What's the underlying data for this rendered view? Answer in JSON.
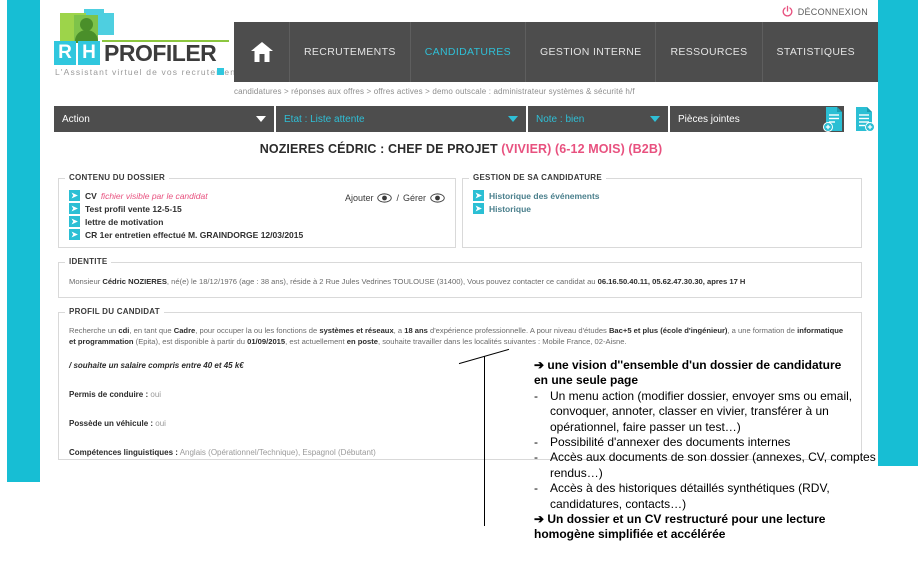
{
  "brand": {
    "letters": [
      "R",
      "H"
    ],
    "word": "PROFILER",
    "tagline": "L'Assistant  virtuel  de  vos  recrutements",
    "accent": "#30c7de",
    "green": "#8cc63f"
  },
  "topbar": {
    "logout_label": "DÉCONNEXION",
    "logout_icon": "power-icon"
  },
  "nav": {
    "home_icon": "house-icon",
    "items": [
      {
        "label": "RECRUTEMENTS",
        "active": false
      },
      {
        "label": "CANDIDATURES",
        "active": true
      },
      {
        "label": "GESTION INTERNE",
        "active": false
      },
      {
        "label": "RESSOURCES",
        "active": false
      },
      {
        "label": "STATISTIQUES",
        "active": false
      }
    ],
    "active_color": "#2fbfd6",
    "bar_color": "#4d4d4d"
  },
  "breadcrumb": {
    "text": "candidatures > réponses aux offres > offres actives > demo outscale : administrateur systèmes & sécurité h/f"
  },
  "toolbar": {
    "action_label": "Action",
    "etat_label": "Etat : Liste attente",
    "note_label": "Note : bien",
    "pieces_jointes_label": "Pièces jointes",
    "icons": [
      "document-add-icon",
      "document-list-add-icon"
    ]
  },
  "candidate": {
    "title_main": "NOZIERES CÉDRIC : CHEF DE PROJET",
    "title_tags": "(VIVIER) (6-12 MOIS) (B2B)",
    "tag_color": "#e8517f"
  },
  "contenu_dossier": {
    "legend": "CONTENU DU DOSSIER",
    "items": [
      {
        "label": "CV",
        "note": "fichier visible par le candidat"
      },
      {
        "label": "Test profil vente 12-5-15",
        "note": ""
      },
      {
        "label": "lettre de motivation",
        "note": ""
      },
      {
        "label": "CR 1er entretien effectué M. GRAINDORGE 12/03/2015",
        "note": ""
      }
    ],
    "add_label": "Ajouter",
    "separator": "/",
    "manage_label": "Gérer"
  },
  "gestion_candidature": {
    "legend": "GESTION DE SA CANDIDATURE",
    "items": [
      {
        "label": "Historique des événements"
      },
      {
        "label": "Historique"
      }
    ]
  },
  "identite": {
    "legend": "IDENTITE",
    "parts": [
      {
        "t": "Monsieur ",
        "b": false
      },
      {
        "t": "Cédric NOZIERES",
        "b": true
      },
      {
        "t": ", né(e) le 18/12/1976 (age : 38 ans), réside à 2 Rue Jules Vedrines TOULOUSE (31400), Vous pouvez contacter ce candidat au ",
        "b": false
      },
      {
        "t": "06.16.50.40.11, 05.62.47.30.30, apres 17 H",
        "b": true
      }
    ]
  },
  "profil": {
    "legend": "PROFIL DU CANDIDAT",
    "summary_parts": [
      {
        "t": "Recherche un ",
        "b": false
      },
      {
        "t": "cdi",
        "b": true
      },
      {
        "t": ", en tant que ",
        "b": false
      },
      {
        "t": "Cadre",
        "b": true
      },
      {
        "t": ", pour occuper la ou les fonctions de ",
        "b": false
      },
      {
        "t": "systèmes et réseaux",
        "b": true
      },
      {
        "t": ", a ",
        "b": false
      },
      {
        "t": "18 ans",
        "b": true
      },
      {
        "t": " d'expérience professionnelle. A pour niveau d'études ",
        "b": false
      },
      {
        "t": "Bac+5 et plus (école d'ingénieur)",
        "b": true
      },
      {
        "t": ", a une formation de ",
        "b": false
      },
      {
        "t": "informatique et programmation",
        "b": true
      },
      {
        "t": " (Epita), est disponible à partir du ",
        "b": false
      },
      {
        "t": "01/09/2015",
        "b": true
      },
      {
        "t": ", est actuellement ",
        "b": false
      },
      {
        "t": "en poste",
        "b": true
      },
      {
        "t": ", souhaite travailler dans les localités suivantes : Mobile France, 02-Aisne.",
        "b": false
      }
    ],
    "rows": [
      {
        "label": "/ souhaite un salaire compris entre 40 et 45 k€",
        "value": ""
      },
      {
        "label": "Permis de conduire :",
        "value": " oui"
      },
      {
        "label": "Possède un véhicule :",
        "value": " oui"
      },
      {
        "label": "Compétences linguistiques :",
        "value": " Anglais (Opérationnel/Technique), Espagnol (Débutant)"
      }
    ]
  },
  "annotation": {
    "head_line1": "➔ une vision d''ensemble d'un dossier de candidature",
    "head_line2": "en une seule page",
    "bullets": [
      "Un menu action (modifier dossier, envoyer sms ou email, convoquer, annoter, classer en vivier, transférer à un opérationnel, faire passer un test…)",
      "Possibilité d'annexer des documents internes",
      "Accès aux documents de son dossier (annexes, CV, comptes rendus…)",
      "Accès à des historiques détaillés synthétiques (RDV, candidatures, contacts…)"
    ],
    "bullet_marker": "-",
    "foot_line1": "➔ Un dossier et un CV restructuré pour une lecture",
    "foot_line2": "homogène simplifiée et accélérée"
  }
}
